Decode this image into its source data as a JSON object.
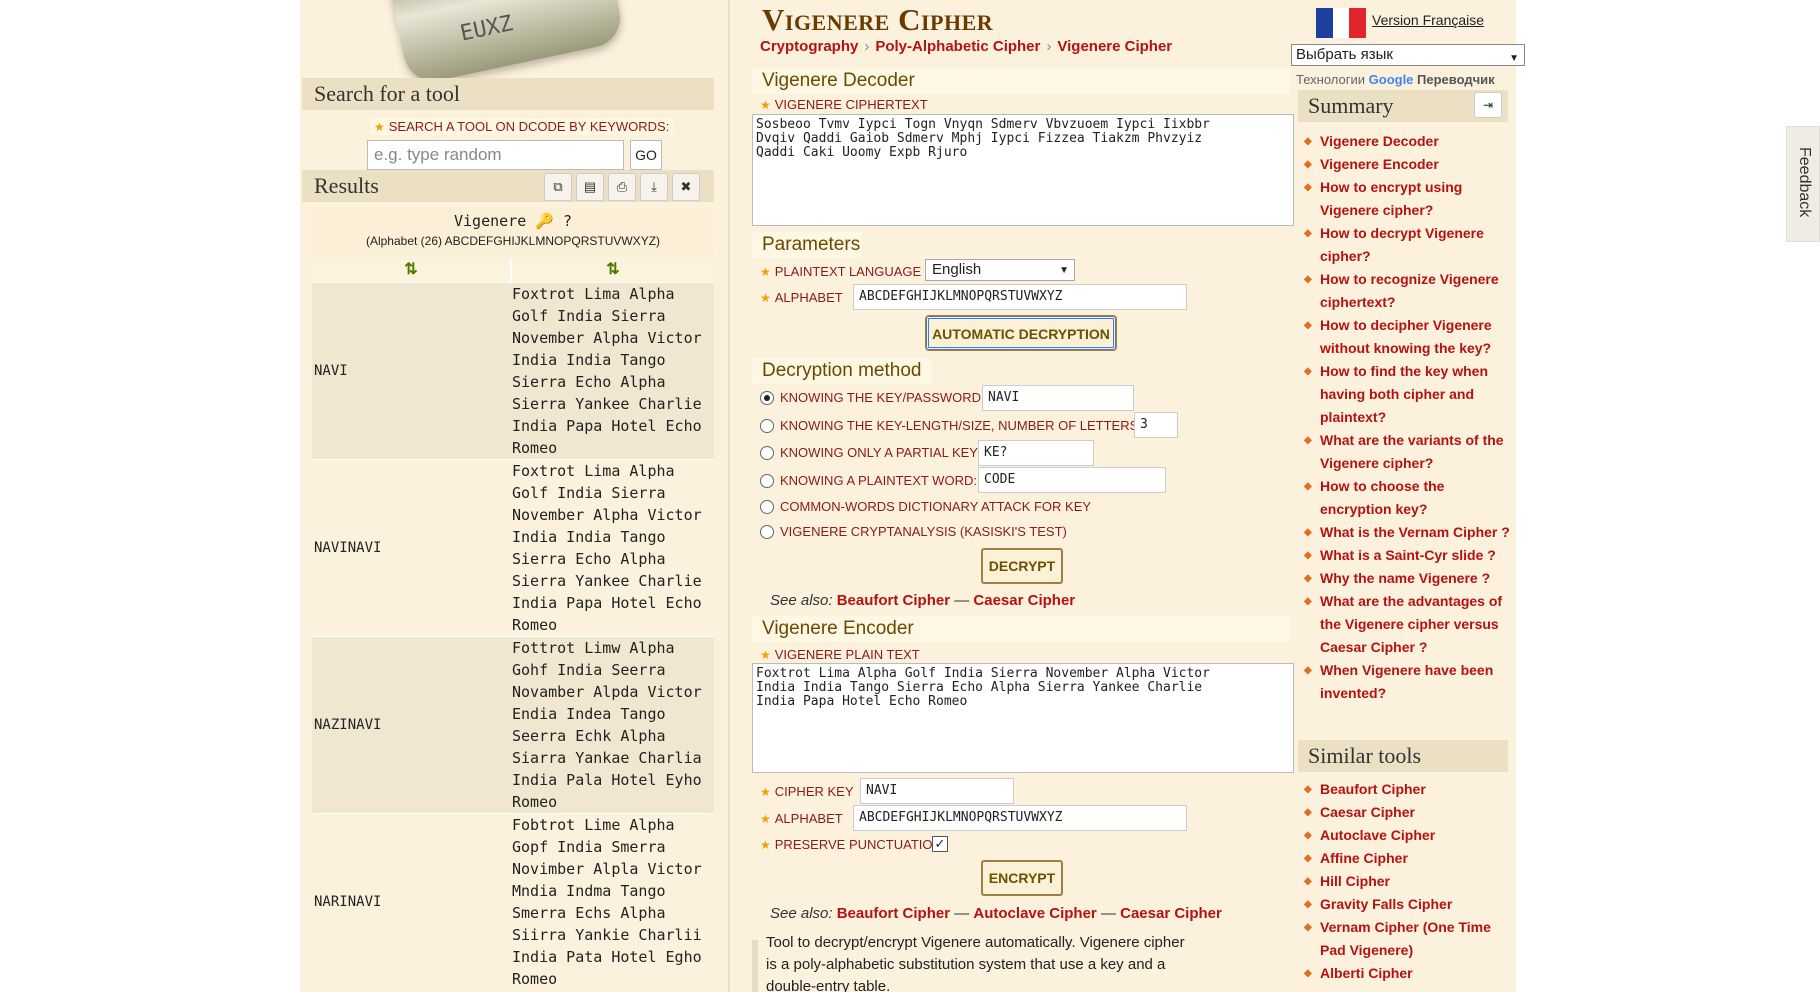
{
  "left": {
    "search_heading": "Search for a tool",
    "search_label": "SEARCH A TOOL ON DCODE BY KEYWORDS:",
    "search_placeholder": "e.g. type random",
    "go_label": "GO",
    "results_heading": "Results",
    "result_title": "Vigenere 🔑 ?",
    "result_alphabet": "(Alphabet (26) ABCDEFGHIJKLMNOPQRSTUVWXYZ)",
    "sort_col1": "⇅",
    "sort_col2": "⇅",
    "rows": [
      {
        "key": "NAVI",
        "lines": [
          "Foxtrot Lima Alpha",
          "Golf India Sierra",
          "November Alpha Victor",
          "India India Tango",
          "Sierra Echo Alpha",
          "Sierra Yankee Charlie",
          "India Papa Hotel Echo",
          "Romeo"
        ]
      },
      {
        "key": "NAVINAVI",
        "lines": [
          "Foxtrot Lima Alpha",
          "Golf India Sierra",
          "November Alpha Victor",
          "India India Tango",
          "Sierra Echo Alpha",
          "Sierra Yankee Charlie",
          "India Papa Hotel Echo",
          "Romeo"
        ]
      },
      {
        "key": "NAZINAVI",
        "lines": [
          "Fottrot Limw Alpha",
          "Gohf India Seerra",
          "Novamber Alpda Victor",
          "Endia Indea Tango",
          "Seerra Echk Alpha",
          "Siarra Yankae Charlia",
          "India Pala Hotel Eyho",
          "Romeo"
        ]
      },
      {
        "key": "NARINAVI",
        "lines": [
          "Fobtrot Lime Alpha",
          "Gopf India Smerra",
          "Novimber Alpla Victor",
          "Mndia Indma Tango",
          "Smerra Echs Alpha",
          "Siirra Yankie Charlii",
          "India Pata Hotel Egho",
          "Romeo"
        ]
      }
    ]
  },
  "center": {
    "title": "Vigenere Cipher",
    "breadcrumbs": [
      "Cryptography",
      "Poly-Alphabetic Cipher",
      "Vigenere Cipher"
    ],
    "decoder_heading": "Vigenere Decoder",
    "ciphertext_label": "VIGENERE CIPHERTEXT",
    "ciphertext": "Sosbeoo Tvmv Iypci Togn Vnyqn Sdmerv Vbvzuoem Iypci Iixbbr\nDvqiv Qaddi Gaiob Sdmerv Mphj Iypci Fizzea Tiakzm Phvzyiz\nQaddi Caki Uoomy Expb Rjuro",
    "params_heading": "Parameters",
    "plaintext_language_label": "PLAINTEXT LANGUAGE",
    "plaintext_language": "English",
    "alphabet_label": "ALPHABET",
    "alphabet": "ABCDEFGHIJKLMNOPQRSTUVWXYZ",
    "auto_decrypt": "AUTOMATIC DECRYPTION",
    "method_heading": "Decryption method",
    "methods": {
      "key": "KNOWING THE KEY/PASSWORD:",
      "key_value": "NAVI",
      "keylen": "KNOWING THE KEY-LENGTH/SIZE, NUMBER OF LETTERS:",
      "keylen_value": "3",
      "partial": "KNOWING ONLY A PARTIAL KEY:",
      "partial_value": "KE?",
      "word": "KNOWING A PLAINTEXT WORD:",
      "word_value": "CODE",
      "dict": "COMMON-WORDS DICTIONARY ATTACK FOR KEY",
      "kasiski": "VIGENERE CRYPTANALYSIS (KASISKI'S TEST)"
    },
    "decrypt": "DECRYPT",
    "see_also_label": "See also:",
    "see_also_1": [
      "Beaufort Cipher",
      "Caesar Cipher"
    ],
    "encoder_heading": "Vigenere Encoder",
    "plaintext_label": "VIGENERE PLAIN TEXT",
    "plaintext": "Foxtrot Lima Alpha Golf India Sierra November Alpha Victor\nIndia India Tango Sierra Echo Alpha Sierra Yankee Charlie\nIndia Papa Hotel Echo Romeo",
    "cipher_key_label": "CIPHER KEY",
    "cipher_key": "NAVI",
    "alphabet2_label": "ALPHABET",
    "alphabet2": "ABCDEFGHIJKLMNOPQRSTUVWXYZ",
    "preserve_label": "PRESERVE PUNCTUATION",
    "encrypt": "ENCRYPT",
    "see_also_2": [
      "Beaufort Cipher",
      "Autoclave Cipher",
      "Caesar Cipher"
    ],
    "description": "Tool to decrypt/encrypt Vigenere automatically. Vigenere cipher is a poly-alphabetic substitution system that use a key and a double-entry table."
  },
  "right": {
    "version_link": "Version Française",
    "language_select": "Выбрать язык",
    "powered_prefix": "Технологии",
    "powered_google": "Google",
    "powered_suffix": "Переводчик",
    "summary_heading": "Summary",
    "summary_items": [
      "Vigenere Decoder",
      "Vigenere Encoder",
      "How to encrypt using Vigenere cipher?",
      "How to decrypt Vigenere cipher?",
      "How to recognize Vigenere ciphertext?",
      "How to decipher Vigenere without knowing the key?",
      "How to find the key when having both cipher and plaintext?",
      "What are the variants of the Vigenere cipher?",
      "How to choose the encryption key?",
      "What is the Vernam Cipher ?",
      "What is a Saint-Cyr slide ?",
      "Why the name Vigenere ?",
      "What are the advantages of the Vigenere cipher versus Caesar Cipher ?",
      "When Vigenere have been invented?"
    ],
    "similar_heading": "Similar tools",
    "similar_items": [
      "Beaufort Cipher",
      "Caesar Cipher",
      "Autoclave Cipher",
      "Affine Cipher",
      "Hill Cipher",
      "Gravity Falls Cipher",
      "Vernam Cipher (One Time Pad Vigenere)",
      "Alberti Cipher"
    ],
    "feedback": "Feedback"
  },
  "colors": {
    "link_red": "#b51212",
    "panel_bg": "#fbf1dc",
    "heading_bg": "#ece0c4",
    "title_brown": "#6b3a00"
  }
}
